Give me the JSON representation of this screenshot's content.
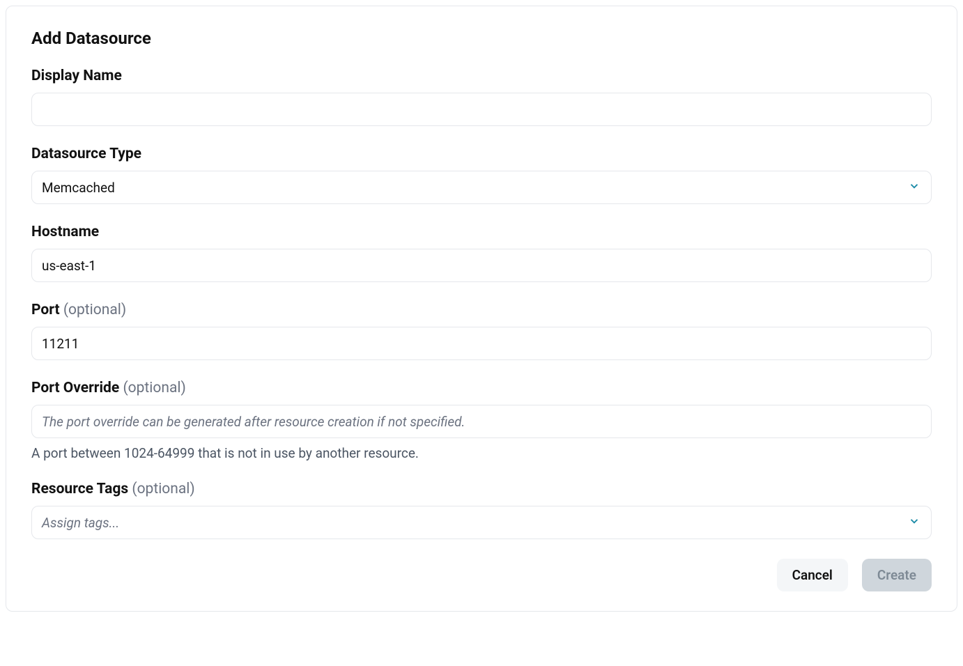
{
  "title": "Add Datasource",
  "fields": {
    "display_name": {
      "label": "Display Name",
      "value": ""
    },
    "datasource_type": {
      "label": "Datasource Type",
      "selected": "Memcached"
    },
    "hostname": {
      "label": "Hostname",
      "value": "us-east-1"
    },
    "port": {
      "label": "Port",
      "optional_text": "(optional)",
      "value": "11211"
    },
    "port_override": {
      "label": "Port Override",
      "optional_text": "(optional)",
      "placeholder": "The port override can be generated after resource creation if not specified.",
      "help": "A port between 1024-64999 that is not in use by another resource."
    },
    "resource_tags": {
      "label": "Resource Tags",
      "optional_text": "(optional)",
      "placeholder": "Assign tags..."
    }
  },
  "actions": {
    "cancel": "Cancel",
    "create": "Create"
  }
}
